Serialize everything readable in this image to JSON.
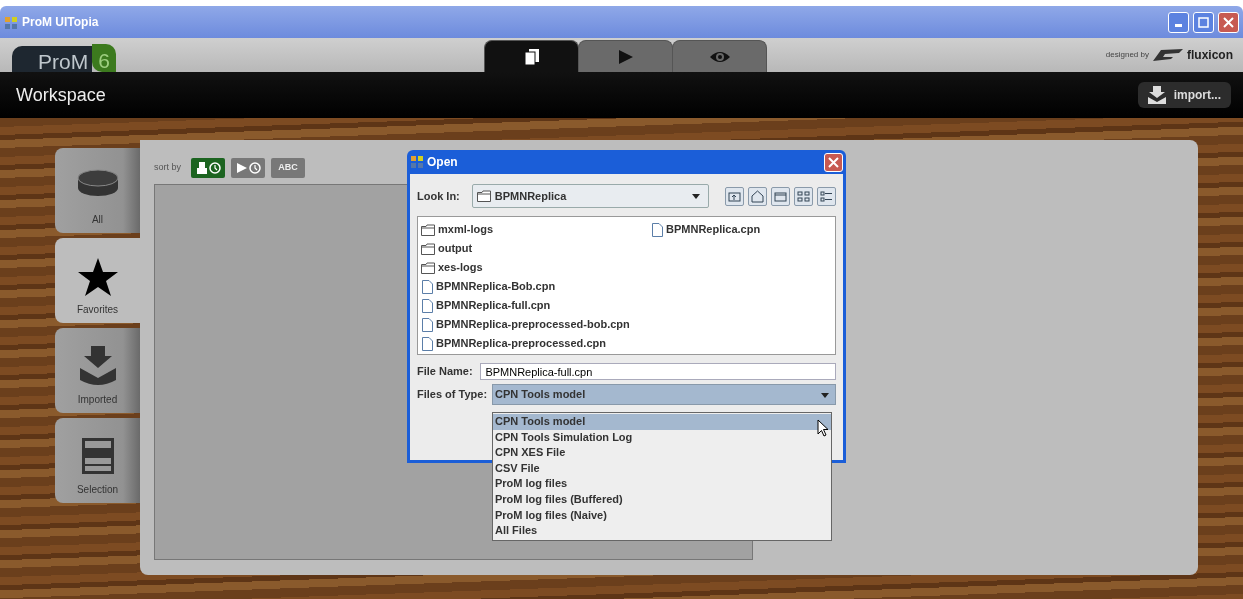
{
  "window": {
    "title": "ProM UITopia"
  },
  "header": {
    "logo_text": "ProM",
    "logo_version": "6",
    "view_tabs": [
      {
        "kind": "workspace",
        "selected": true
      },
      {
        "kind": "action",
        "selected": false
      },
      {
        "kind": "view",
        "selected": false
      }
    ],
    "designed_by": "designed by",
    "brand": "fluxicon"
  },
  "workspace_bar": {
    "title": "Workspace",
    "import_button": "import..."
  },
  "sidebar": {
    "items": [
      {
        "kind": "all",
        "label": "All",
        "selected": false
      },
      {
        "kind": "favorites",
        "label": "Favorites",
        "selected": true
      },
      {
        "kind": "imported",
        "label": "Imported",
        "selected": false
      },
      {
        "kind": "selection",
        "label": "Selection",
        "selected": false
      }
    ]
  },
  "sort": {
    "label": "sort by",
    "buttons": [
      {
        "kind": "created",
        "selected": true
      },
      {
        "kind": "run",
        "selected": false
      },
      {
        "kind": "alpha",
        "label": "ABC",
        "selected": false
      }
    ]
  },
  "dialog": {
    "title": "Open",
    "look_in_label": "Look In:",
    "look_in_value": "BPMNReplica",
    "files": [
      {
        "kind": "folder",
        "name": "mxml-logs"
      },
      {
        "kind": "folder",
        "name": "output"
      },
      {
        "kind": "folder",
        "name": "xes-logs"
      },
      {
        "kind": "file",
        "name": "BPMNReplica-Bob.cpn"
      },
      {
        "kind": "file",
        "name": "BPMNReplica-full.cpn"
      },
      {
        "kind": "file",
        "name": "BPMNReplica-preprocessed-bob.cpn"
      },
      {
        "kind": "file",
        "name": "BPMNReplica-preprocessed.cpn"
      },
      {
        "kind": "file",
        "name": "BPMNReplica.cpn"
      }
    ],
    "file_name_label": "File Name:",
    "file_name_value": "BPMNReplica-full.cpn",
    "type_label": "Files of Type:",
    "type_value": "CPN Tools model",
    "type_options": [
      {
        "label": "CPN Tools model",
        "selected": true
      },
      {
        "label": "CPN Tools Simulation Log",
        "selected": false
      },
      {
        "label": "CPN XES File",
        "selected": false
      },
      {
        "label": "CSV File",
        "selected": false
      },
      {
        "label": "ProM log files",
        "selected": false
      },
      {
        "label": "ProM log files (Buffered)",
        "selected": false
      },
      {
        "label": "ProM log files (Naive)",
        "selected": false
      },
      {
        "label": "All Files",
        "selected": false
      }
    ]
  }
}
